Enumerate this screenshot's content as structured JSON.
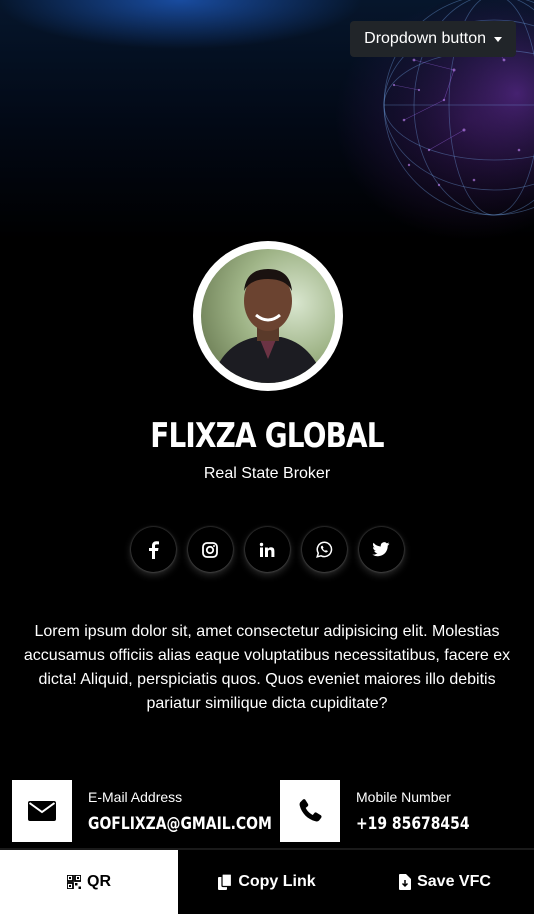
{
  "header": {
    "dropdown_label": "Dropdown button"
  },
  "profile": {
    "name": "FLIXZA GLOBAL",
    "title": "Real State Broker"
  },
  "social": [
    {
      "icon": "facebook-icon",
      "glyph": "f"
    },
    {
      "icon": "instagram-icon",
      "glyph": ""
    },
    {
      "icon": "linkedin-icon",
      "glyph": "in"
    },
    {
      "icon": "whatsapp-icon",
      "glyph": ""
    },
    {
      "icon": "twitter-icon",
      "glyph": ""
    }
  ],
  "bio": "Lorem ipsum dolor sit, amet consectetur adipisicing elit. Molestias accusamus officiis alias eaque voluptatibus necessitatibus, facere ex dicta! Aliquid, perspiciatis quos. Quos eveniet maiores illo debitis pariatur similique dicta cupiditate?",
  "contacts": {
    "email": {
      "label": "E-Mail Address",
      "value": "GOFLIXZA@GMAIL.COM",
      "icon": "envelope-icon"
    },
    "phone": {
      "label": "Mobile Number",
      "value": "+19 85678454",
      "icon": "phone-icon"
    }
  },
  "bottom_bar": {
    "qr": "QR",
    "copy": "Copy Link",
    "save": "Save VFC"
  }
}
